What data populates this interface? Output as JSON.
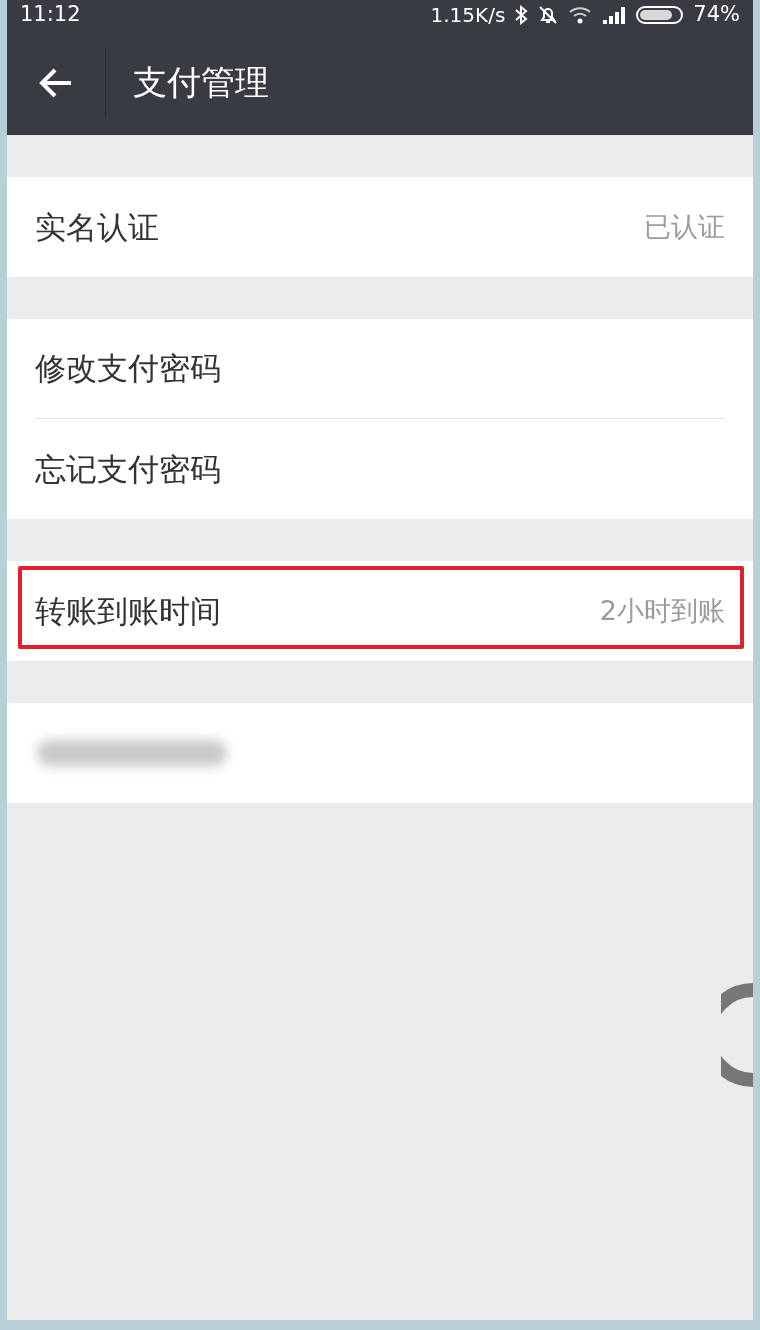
{
  "status_bar": {
    "time": "11:12",
    "network_speed": "1.15K/s",
    "battery": "74%"
  },
  "header": {
    "title": "支付管理"
  },
  "groups": [
    {
      "rows": [
        {
          "kind": "item",
          "label": "实名认证",
          "value": "已认证",
          "highlighted": false
        }
      ]
    },
    {
      "rows": [
        {
          "kind": "item",
          "label": "修改支付密码",
          "highlighted": false
        },
        {
          "kind": "item",
          "label": "忘记支付密码",
          "highlighted": false
        }
      ]
    },
    {
      "rows": [
        {
          "kind": "item",
          "label": "转账到账时间",
          "value": "2小时到账",
          "highlighted": true
        }
      ]
    },
    {
      "rows": [
        {
          "kind": "redacted"
        }
      ]
    }
  ]
}
